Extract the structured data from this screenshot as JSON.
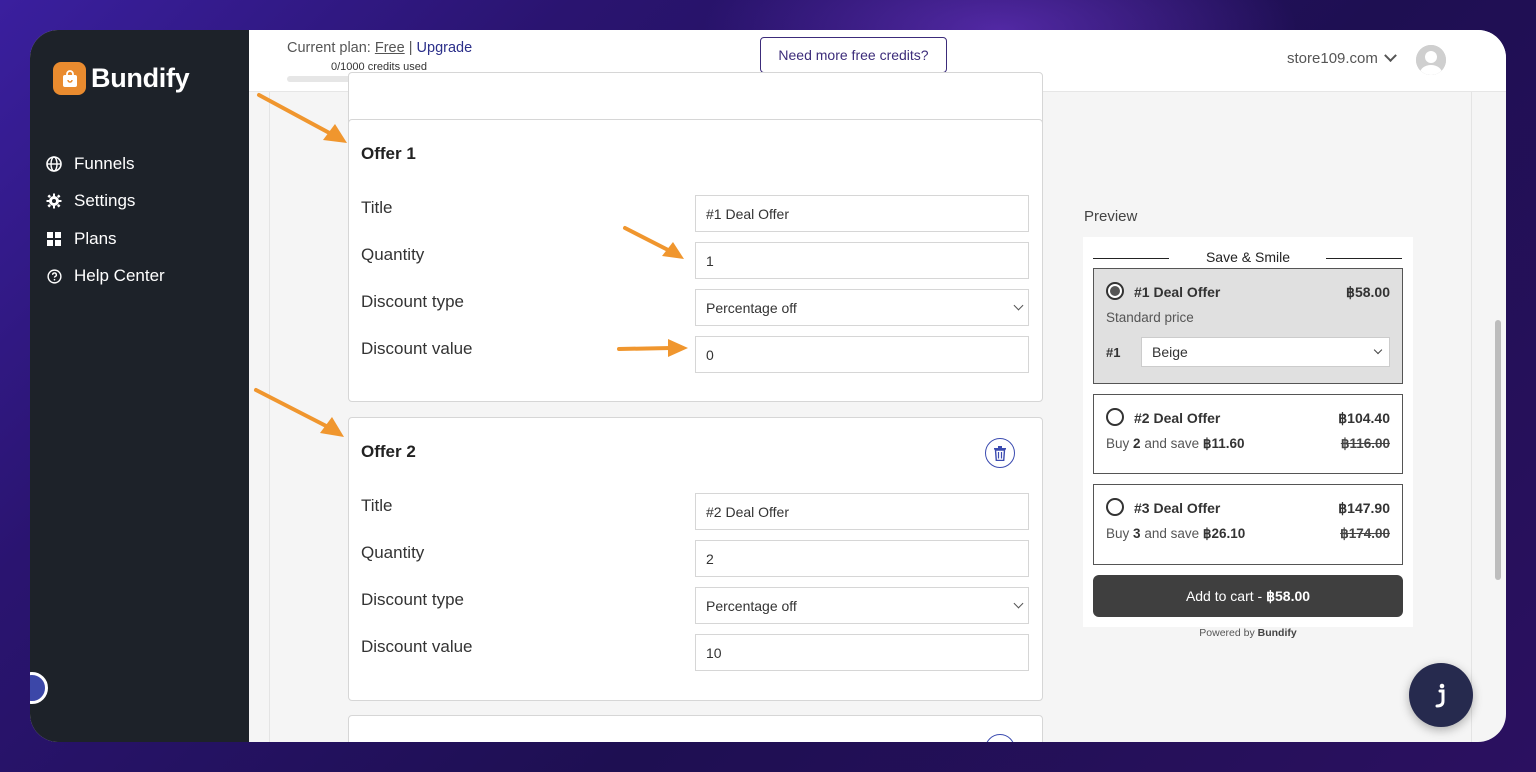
{
  "sidebar": {
    "logo_text": "Bundify",
    "items": [
      {
        "label": "Funnels",
        "icon": "globe-icon"
      },
      {
        "label": "Settings",
        "icon": "gear-icon"
      },
      {
        "label": "Plans",
        "icon": "grid-icon"
      },
      {
        "label": "Help Center",
        "icon": "help-icon"
      }
    ]
  },
  "topbar": {
    "plan_prefix": "Current plan:",
    "plan_name": "Free",
    "separator": "|",
    "upgrade_label": "Upgrade",
    "credits_text": "0/1000 credits used",
    "credits_fraction": 0,
    "more_credits_label": "Need more free credits?",
    "store_name": "store109.com"
  },
  "offers": [
    {
      "title": "Offer 1",
      "fields": [
        {
          "label": "Title",
          "value": "#1 Deal Offer"
        },
        {
          "label": "Quantity",
          "value": "1"
        },
        {
          "label": "Discount type",
          "value": "Percentage off"
        },
        {
          "label": "Discount value",
          "value": "0"
        }
      ]
    },
    {
      "title": "Offer 2",
      "fields": [
        {
          "label": "Title",
          "value": "#2 Deal Offer"
        },
        {
          "label": "Quantity",
          "value": "2"
        },
        {
          "label": "Discount type",
          "value": "Percentage off"
        },
        {
          "label": "Discount value",
          "value": "10"
        }
      ]
    }
  ],
  "preview": {
    "label": "Preview",
    "heading": "Save & Smile",
    "offers": [
      {
        "name": "#1 Deal Offer",
        "price": "฿58.00",
        "sub": "Standard price",
        "variant_label": "#1",
        "variant_value": "Beige",
        "selected": true
      },
      {
        "name": "#2 Deal Offer",
        "price": "฿104.40",
        "sub_prefix": "Buy",
        "qty": "2",
        "sub_mid": "and save",
        "saving": "฿11.60",
        "original": "฿116.00",
        "selected": false
      },
      {
        "name": "#3 Deal Offer",
        "price": "฿147.90",
        "sub_prefix": "Buy",
        "qty": "3",
        "sub_mid": "and save",
        "saving": "฿26.10",
        "original": "฿174.00",
        "selected": false
      }
    ],
    "add_to_cart": "Add to cart - ",
    "add_to_cart_price": "฿58.00",
    "powered_prefix": "Powered by",
    "powered_brand": "Bundify"
  },
  "colors": {
    "accent": "#e98b2f",
    "sidebar_bg": "#1d2229",
    "primary": "#3c2c7a",
    "button_dark": "#3f3f3f"
  }
}
